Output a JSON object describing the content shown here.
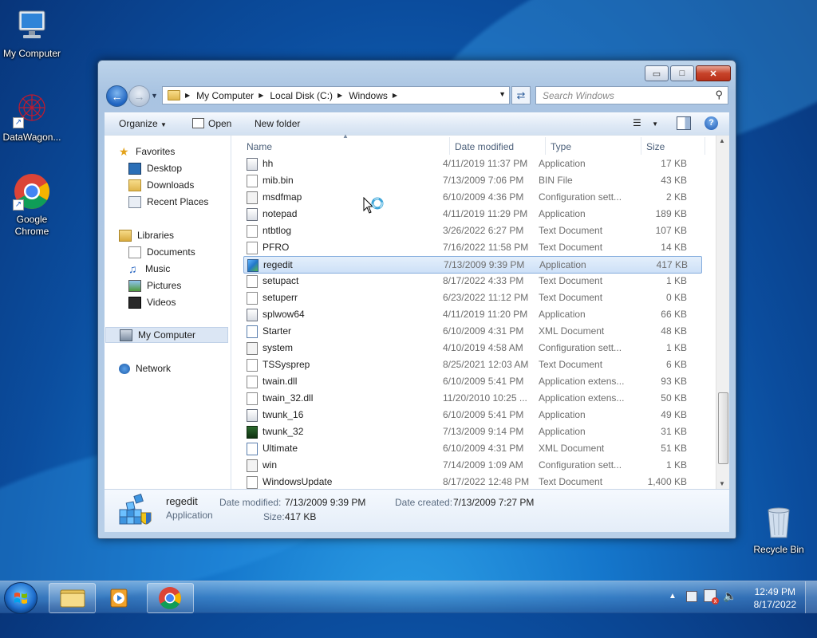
{
  "desktop": {
    "icons": [
      {
        "label": "My Computer"
      },
      {
        "label": "DataWagon..."
      },
      {
        "label": "Google Chrome"
      },
      {
        "label": "Recycle Bin"
      }
    ]
  },
  "window": {
    "caption_buttons": {
      "minimize": "▭",
      "maximize": "□",
      "close": "✕"
    },
    "breadcrumb": [
      "My Computer",
      "Local Disk (C:)",
      "Windows"
    ],
    "search_placeholder": "Search Windows",
    "toolbar": {
      "organize": "Organize",
      "open": "Open",
      "new_folder": "New folder"
    },
    "nav": {
      "favorites": "Favorites",
      "desktop": "Desktop",
      "downloads": "Downloads",
      "recent": "Recent Places",
      "libraries": "Libraries",
      "documents": "Documents",
      "music": "Music",
      "pictures": "Pictures",
      "videos": "Videos",
      "computer": "My Computer",
      "network": "Network"
    },
    "columns": {
      "name": "Name",
      "date": "Date modified",
      "type": "Type",
      "size": "Size"
    },
    "files": [
      {
        "name": "hh",
        "date": "4/11/2019 11:37 PM",
        "type": "Application",
        "size": "17 KB",
        "icon": "app-icon"
      },
      {
        "name": "mib.bin",
        "date": "7/13/2009 7:06 PM",
        "type": "BIN File",
        "size": "43 KB",
        "icon": "file-icon"
      },
      {
        "name": "msdfmap",
        "date": "6/10/2009 4:36 PM",
        "type": "Configuration sett...",
        "size": "2 KB",
        "icon": "config-icon"
      },
      {
        "name": "notepad",
        "date": "4/11/2019 11:29 PM",
        "type": "Application",
        "size": "189 KB",
        "icon": "app-icon"
      },
      {
        "name": "ntbtlog",
        "date": "3/26/2022 6:27 PM",
        "type": "Text Document",
        "size": "107 KB",
        "icon": "text-file-icon"
      },
      {
        "name": "PFRO",
        "date": "7/16/2022 11:58 PM",
        "type": "Text Document",
        "size": "14 KB",
        "icon": "text-file-icon"
      },
      {
        "name": "regedit",
        "date": "7/13/2009 9:39 PM",
        "type": "Application",
        "size": "417 KB",
        "icon": "regedit-icon"
      },
      {
        "name": "setupact",
        "date": "8/17/2022 4:33 PM",
        "type": "Text Document",
        "size": "1 KB",
        "icon": "text-file-icon"
      },
      {
        "name": "setuperr",
        "date": "6/23/2022 11:12 PM",
        "type": "Text Document",
        "size": "0 KB",
        "icon": "text-file-icon"
      },
      {
        "name": "splwow64",
        "date": "4/11/2019 11:20 PM",
        "type": "Application",
        "size": "66 KB",
        "icon": "app-icon"
      },
      {
        "name": "Starter",
        "date": "6/10/2009 4:31 PM",
        "type": "XML Document",
        "size": "48 KB",
        "icon": "xml-icon"
      },
      {
        "name": "system",
        "date": "4/10/2019 4:58 AM",
        "type": "Configuration sett...",
        "size": "1 KB",
        "icon": "config-icon"
      },
      {
        "name": "TSSysprep",
        "date": "8/25/2021 12:03 AM",
        "type": "Text Document",
        "size": "6 KB",
        "icon": "text-file-icon"
      },
      {
        "name": "twain.dll",
        "date": "6/10/2009 5:41 PM",
        "type": "Application extens...",
        "size": "93 KB",
        "icon": "dll-icon"
      },
      {
        "name": "twain_32.dll",
        "date": "11/20/2010 10:25 ...",
        "type": "Application extens...",
        "size": "50 KB",
        "icon": "dll-icon"
      },
      {
        "name": "twunk_16",
        "date": "6/10/2009 5:41 PM",
        "type": "Application",
        "size": "49 KB",
        "icon": "app-icon"
      },
      {
        "name": "twunk_32",
        "date": "7/13/2009 9:14 PM",
        "type": "Application",
        "size": "31 KB",
        "icon": "twunk-icon"
      },
      {
        "name": "Ultimate",
        "date": "6/10/2009 4:31 PM",
        "type": "XML Document",
        "size": "51 KB",
        "icon": "xml-icon"
      },
      {
        "name": "win",
        "date": "7/14/2009 1:09 AM",
        "type": "Configuration sett...",
        "size": "1 KB",
        "icon": "config-icon"
      },
      {
        "name": "WindowsUpdate",
        "date": "8/17/2022 12:48 PM",
        "type": "Text Document",
        "size": "1,400 KB",
        "icon": "text-file-icon"
      }
    ],
    "selected_file": "regedit",
    "details": {
      "name": "regedit",
      "type": "Application",
      "date_modified_label": "Date modified:",
      "date_modified": "7/13/2009 9:39 PM",
      "date_created_label": "Date created:",
      "date_created": "7/13/2009 7:27 PM",
      "size_label": "Size:",
      "size": "417 KB"
    }
  },
  "taskbar": {
    "time": "12:49 PM",
    "date": "8/17/2022"
  },
  "colors": {
    "selection": "#cde0f7",
    "selection_border": "#84acdd",
    "window_frame": "#b8cfe8",
    "close_button": "#c7432a"
  }
}
